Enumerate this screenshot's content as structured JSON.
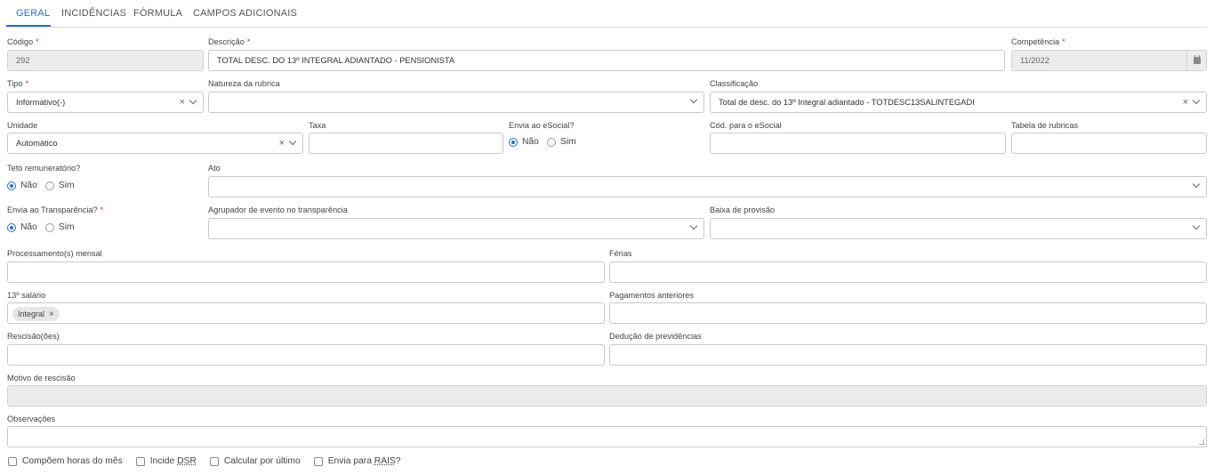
{
  "tabs": [
    "GERAL",
    "INCIDÊNCIAS",
    "FÓRMULA",
    "CAMPOS ADICIONAIS"
  ],
  "fields": {
    "codigo": {
      "label": "Código",
      "required": "*",
      "value": "292"
    },
    "descricao": {
      "label": "Descrição",
      "required": "*",
      "value": "TOTAL DESC. DO 13º INTEGRAL ADIANTADO - PENSIONISTA"
    },
    "competencia": {
      "label": "Competência",
      "required": "*",
      "value": "11/2022",
      "icon": "calendar-icon"
    },
    "tipo": {
      "label": "Tipo",
      "required": "*",
      "value": "Informativo(-)"
    },
    "natureza": {
      "label": "Natureza da rubrica",
      "value": ""
    },
    "classificacao": {
      "label": "Classificação",
      "value": "Total de desc. do 13º Integral adiantado - TOTDESC13SALINTEGADI"
    },
    "unidade": {
      "label": "Unidade",
      "value": "Automático"
    },
    "taxa": {
      "label": "Taxa",
      "value": ""
    },
    "envia_esocial": {
      "label": "Envia ao eSocial?",
      "options": [
        "Não",
        "Sim"
      ],
      "selected": "Não"
    },
    "cod_esocial": {
      "label": "Cód. para o eSocial",
      "value": ""
    },
    "tabela_rubricas": {
      "label": "Tabela de rubricas",
      "value": ""
    },
    "teto": {
      "label": "Teto remuneratório?",
      "options": [
        "Não",
        "Sim"
      ],
      "selected": "Não"
    },
    "ato": {
      "label": "Ato",
      "value": ""
    },
    "envia_transparencia": {
      "label": "Envia ao Transparência?",
      "required": "*",
      "options": [
        "Não",
        "Sim"
      ],
      "selected": "Não"
    },
    "agrupador": {
      "label": "Agrupador de evento no transparência",
      "value": ""
    },
    "baixa_provisao": {
      "label": "Baixa de provisão",
      "value": ""
    },
    "processamento_mensal": {
      "label": "Processamento(s) mensal",
      "value": ""
    },
    "ferias": {
      "label": "Férias",
      "value": ""
    },
    "decimo_terceiro": {
      "label": "13º salário",
      "chips": [
        "Integral"
      ]
    },
    "pagamentos_anteriores": {
      "label": "Pagamentos anteriores",
      "value": ""
    },
    "rescisao": {
      "label": "Rescisão(ões)",
      "value": ""
    },
    "deducao": {
      "label": "Dedução de previdências",
      "value": ""
    },
    "motivo_rescisao": {
      "label": "Motivo de rescisão",
      "value": ""
    },
    "observacoes": {
      "label": "Observações",
      "value": ""
    }
  },
  "checkboxes": [
    {
      "label": "Compõem horas do mês",
      "checked": false
    },
    {
      "label_pre": "Incide ",
      "label_ul": "DSR",
      "checked": false
    },
    {
      "label": "Calcular por último",
      "checked": false
    },
    {
      "label_pre": "Envia para ",
      "label_ul": "RAIS",
      "label_post": "?",
      "checked": false
    }
  ],
  "colors": {
    "accent": "#2a6fcc",
    "required": "#d93025",
    "disabled_bg": "#ececec",
    "border": "#c9c9c9"
  },
  "icons": {
    "clear": "×",
    "chevron": "chevron-down-icon",
    "chip_remove": "×"
  }
}
